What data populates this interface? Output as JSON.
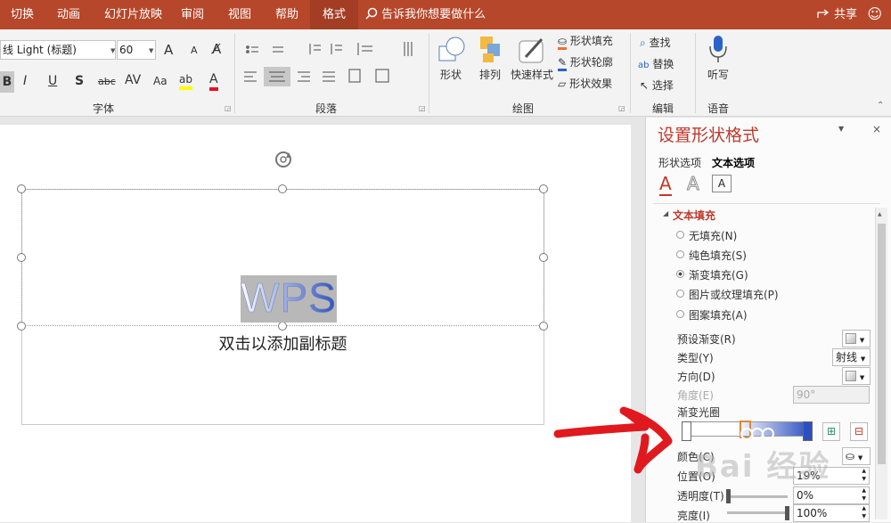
{
  "tabs": [
    "切换",
    "动画",
    "幻灯片放映",
    "审阅",
    "视图",
    "帮助",
    "格式"
  ],
  "tell_me": "告诉我你想要做什么",
  "share": "共享",
  "font": {
    "name": "线 Light (标题)",
    "size": "60",
    "bold": "B",
    "italic": "I",
    "underline": "U",
    "strike": "S",
    "spacing": "abc",
    "char_spacing": "AV",
    "case": "Aa",
    "highlight": "ab",
    "color": "A",
    "grow": "A",
    "shrink": "A",
    "label": "字体"
  },
  "paragraph": {
    "label": "段落"
  },
  "drawing": {
    "shapes": "形状",
    "arrange": "排列",
    "quick_styles": "快速样式",
    "shape_fill": "形状填充",
    "shape_outline": "形状轮廓",
    "shape_effects": "形状效果",
    "label": "绘图"
  },
  "editing": {
    "find": "查找",
    "replace": "替换",
    "select": "选择",
    "label": "编辑"
  },
  "voice": {
    "dictate": "听写",
    "label": "语音"
  },
  "slide": {
    "title_text": "WPS",
    "subtitle_placeholder": "双击以添加副标题"
  },
  "pane": {
    "title": "设置形状格式",
    "tab_shape": "形状选项",
    "tab_text": "文本选项",
    "section": "文本填充",
    "options": [
      "无填充(N)",
      "纯色填充(S)",
      "渐变填充(G)",
      "图片或纹理填充(P)",
      "图案填充(A)"
    ],
    "selected_option": "渐变填充(G)",
    "preset_gradient": "预设渐变(R)",
    "type_label": "类型(Y)",
    "type_value": "射线",
    "direction": "方向(D)",
    "angle_label": "角度(E)",
    "angle_value": "90°",
    "gradient_stops": "渐变光圈",
    "color_label": "颜色(C)",
    "position_label": "位置(O)",
    "position_value": "19%",
    "transparency_label": "透明度(T)",
    "transparency_value": "0%",
    "brightness_label": "亮度(I)",
    "brightness_value": "100%"
  },
  "watermark": "Bai 经验",
  "colors": {
    "accent": "#b7472a",
    "pane_title": "#c0392b",
    "gradient_start": "#ffffff",
    "gradient_end": "#2c4fc0",
    "annotation": "#e0191f"
  }
}
